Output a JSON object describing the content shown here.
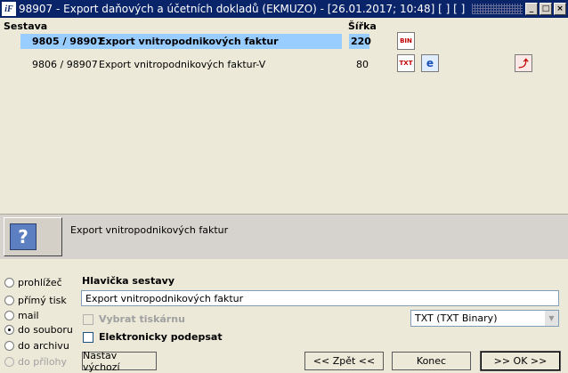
{
  "window": {
    "title": "98907 - Export daňových a účetních dokladů (EKMUZO) - [26.01.2017; 10:48] [ ] [ ]",
    "app_icon_label": "iF",
    "controls": [
      "_",
      "□",
      "×"
    ]
  },
  "report_table": {
    "headers": {
      "report": "Sestava",
      "width": "Šířka"
    },
    "rows": [
      {
        "code": "9805 / 98907",
        "name": "Export vnitropodnikových faktur",
        "width": "220",
        "selected": true,
        "icons": [
          "bin-file-icon"
        ]
      },
      {
        "code": "9806 / 98907",
        "name": "Export vnitropodnikových faktur-V",
        "width": "80",
        "selected": false,
        "icons": [
          "txt-file-icon",
          "ie-icon",
          "pdf-icon"
        ]
      }
    ],
    "icon_labels": {
      "bin": "BIN",
      "txt": "TXT",
      "ie": "e",
      "pdf": "⤴"
    }
  },
  "info_panel": {
    "description": "Export vnitropodnikových faktur",
    "printer_glyph": "?"
  },
  "output_options": [
    {
      "label": "prohlížeč",
      "checked": false,
      "disabled": false
    },
    {
      "label": "přímý tisk",
      "checked": false,
      "disabled": false
    },
    {
      "label": "mail",
      "checked": false,
      "disabled": false
    },
    {
      "label": "do souboru",
      "checked": true,
      "disabled": false
    },
    {
      "label": "do archivu",
      "checked": false,
      "disabled": false
    },
    {
      "label": "do přílohy",
      "checked": false,
      "disabled": true
    }
  ],
  "form": {
    "header_label": "Hlavička sestavy",
    "header_value": "Export vnitropodnikových faktur",
    "select_printer_label": "Vybrat tiskárnu",
    "esign_label": "Elektronicky podepsat",
    "format_value": "TXT (TXT Binary)",
    "format_arrow": "▼"
  },
  "buttons": {
    "defaults": "Nastav výchozí",
    "back": "<< Zpět <<",
    "end": "Konec",
    "ok": ">> OK >>"
  }
}
